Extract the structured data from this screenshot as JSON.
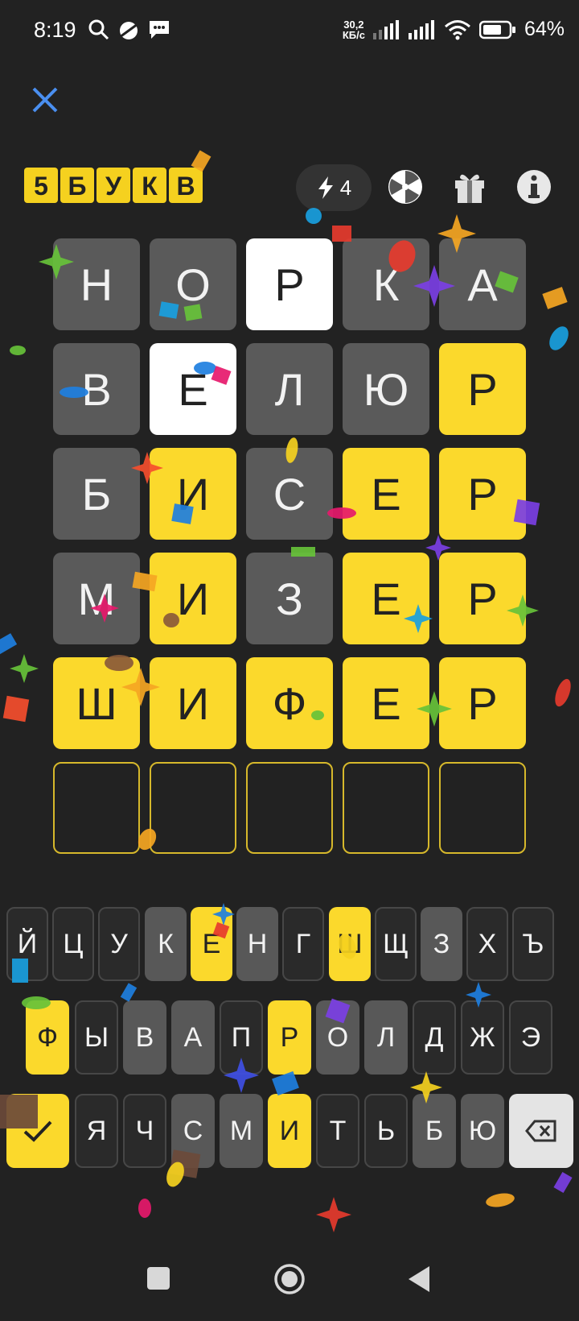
{
  "status_bar": {
    "time": "8:19",
    "net_speed_value": "30,2",
    "net_speed_unit": "КБ/с",
    "battery_percent": "64%"
  },
  "header": {
    "logo_letters": [
      "5",
      "Б",
      "У",
      "К",
      "В"
    ],
    "energy_count": "4",
    "icons": [
      "close-icon",
      "lightning-icon",
      "wheel-icon",
      "gift-icon",
      "info-icon"
    ]
  },
  "grid": {
    "rows": [
      [
        {
          "l": "Н",
          "s": "absent"
        },
        {
          "l": "О",
          "s": "absent"
        },
        {
          "l": "Р",
          "s": "present"
        },
        {
          "l": "К",
          "s": "absent"
        },
        {
          "l": "А",
          "s": "absent"
        }
      ],
      [
        {
          "l": "В",
          "s": "absent"
        },
        {
          "l": "Е",
          "s": "present"
        },
        {
          "l": "Л",
          "s": "absent"
        },
        {
          "l": "Ю",
          "s": "absent"
        },
        {
          "l": "Р",
          "s": "correct"
        }
      ],
      [
        {
          "l": "Б",
          "s": "absent"
        },
        {
          "l": "И",
          "s": "correct"
        },
        {
          "l": "С",
          "s": "absent"
        },
        {
          "l": "Е",
          "s": "correct"
        },
        {
          "l": "Р",
          "s": "correct"
        }
      ],
      [
        {
          "l": "М",
          "s": "absent"
        },
        {
          "l": "И",
          "s": "correct"
        },
        {
          "l": "З",
          "s": "absent"
        },
        {
          "l": "Е",
          "s": "correct"
        },
        {
          "l": "Р",
          "s": "correct"
        }
      ],
      [
        {
          "l": "Ш",
          "s": "correct"
        },
        {
          "l": "И",
          "s": "correct"
        },
        {
          "l": "Ф",
          "s": "correct"
        },
        {
          "l": "Е",
          "s": "correct"
        },
        {
          "l": "Р",
          "s": "correct"
        }
      ],
      [
        {
          "l": "",
          "s": "empty"
        },
        {
          "l": "",
          "s": "empty"
        },
        {
          "l": "",
          "s": "empty"
        },
        {
          "l": "",
          "s": "empty"
        },
        {
          "l": "",
          "s": "empty"
        }
      ]
    ]
  },
  "keyboard": {
    "rows": [
      [
        {
          "k": "Й",
          "s": "unused"
        },
        {
          "k": "Ц",
          "s": "unused"
        },
        {
          "k": "У",
          "s": "unused"
        },
        {
          "k": "К",
          "s": "absent"
        },
        {
          "k": "Е",
          "s": "correct"
        },
        {
          "k": "Н",
          "s": "absent"
        },
        {
          "k": "Г",
          "s": "unused"
        },
        {
          "k": "Ш",
          "s": "correct"
        },
        {
          "k": "Щ",
          "s": "unused"
        },
        {
          "k": "З",
          "s": "absent"
        },
        {
          "k": "Х",
          "s": "unused"
        },
        {
          "k": "Ъ",
          "s": "unused"
        }
      ],
      [
        {
          "k": "Ф",
          "s": "correct"
        },
        {
          "k": "Ы",
          "s": "unused"
        },
        {
          "k": "В",
          "s": "absent"
        },
        {
          "k": "А",
          "s": "absent"
        },
        {
          "k": "П",
          "s": "unused"
        },
        {
          "k": "Р",
          "s": "correct"
        },
        {
          "k": "О",
          "s": "absent"
        },
        {
          "k": "Л",
          "s": "absent"
        },
        {
          "k": "Д",
          "s": "unused"
        },
        {
          "k": "Ж",
          "s": "unused"
        },
        {
          "k": "Э",
          "s": "unused"
        }
      ],
      [
        {
          "k": "",
          "s": "correct"
        },
        {
          "k": "Я",
          "s": "unused"
        },
        {
          "k": "Ч",
          "s": "unused"
        },
        {
          "k": "С",
          "s": "absent"
        },
        {
          "k": "М",
          "s": "absent"
        },
        {
          "k": "И",
          "s": "correct"
        },
        {
          "k": "Т",
          "s": "unused"
        },
        {
          "k": "Ь",
          "s": "unused"
        },
        {
          "k": "Б",
          "s": "absent"
        },
        {
          "k": "Ю",
          "s": "absent"
        },
        {
          "k": "",
          "s": "backspace"
        }
      ]
    ]
  },
  "colors": {
    "background": "#222222",
    "tile_absent": "#5a5a5a",
    "tile_present": "#ffffff",
    "tile_correct": "#fbd92c",
    "accent_blue": "#4a8ff0"
  }
}
